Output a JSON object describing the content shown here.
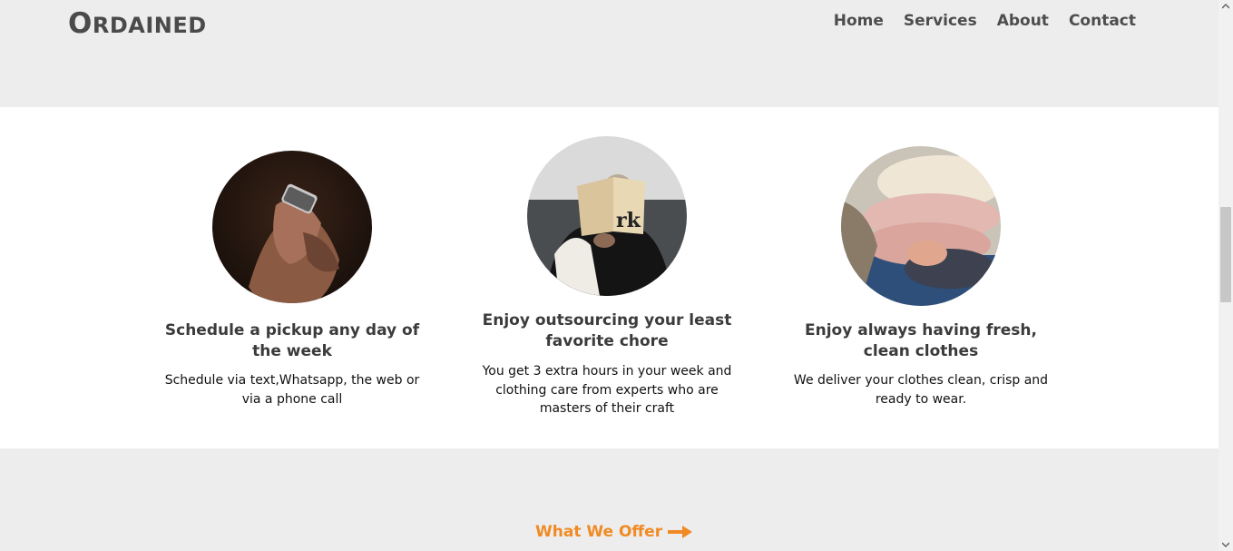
{
  "header": {
    "logo_first": "O",
    "logo_rest": "RDAINED",
    "nav": [
      "Home",
      "Services",
      "About",
      "Contact"
    ]
  },
  "features": [
    {
      "image": "hands-holding-phone",
      "title": "Schedule a pickup any day of the week",
      "text": "Schedule via text,Whatsapp, the web or via a phone call"
    },
    {
      "image": "person-reading-book",
      "title": "Enjoy outsourcing your least favorite chore",
      "text": "You get 3 extra hours in your week and clothing care from experts who are masters of their craft"
    },
    {
      "image": "folded-knit-sweaters",
      "title": "Enjoy always having fresh, clean clothes",
      "text": "We deliver your clothes clean, crisp and ready to wear."
    }
  ],
  "offer": {
    "label": "What We Offer",
    "icon": "arrow-right-icon"
  },
  "colors": {
    "page_bg": "#ededed",
    "band_bg": "#ffffff",
    "accent": "#f08a24",
    "text": "#3b3b3b"
  }
}
